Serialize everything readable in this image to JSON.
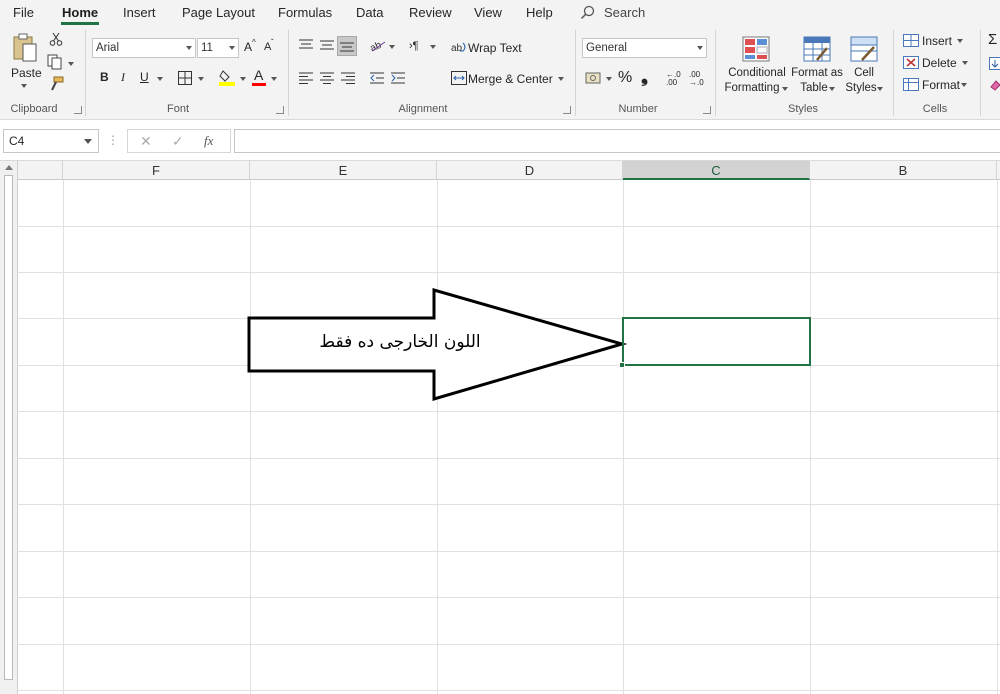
{
  "menu": {
    "tabs": [
      "File",
      "Home",
      "Insert",
      "Page Layout",
      "Formulas",
      "Data",
      "Review",
      "View",
      "Help"
    ],
    "active_tab": "Home",
    "search_label": "Search"
  },
  "ribbon": {
    "clipboard": {
      "paste": "Paste",
      "label": "Clipboard"
    },
    "font": {
      "name": "Arial",
      "size": "11",
      "label": "Font",
      "bold": "B",
      "italic": "I",
      "underline": "U",
      "grow": "A",
      "shrink": "A",
      "font_color": "A"
    },
    "alignment": {
      "wrap_text": "Wrap Text",
      "merge_center": "Merge & Center",
      "label": "Alignment"
    },
    "number": {
      "format": "General",
      "percent": "%",
      "comma": "❟",
      "label": "Number"
    },
    "styles": {
      "conditional_l1": "Conditional",
      "conditional_l2": "Formatting",
      "format_table_l1": "Format as",
      "format_table_l2": "Table",
      "cell_styles_l1": "Cell",
      "cell_styles_l2": "Styles",
      "label": "Styles"
    },
    "cells": {
      "insert": "Insert",
      "delete": "Delete",
      "format": "Format",
      "label": "Cells"
    },
    "colors": {
      "accent": "#217346",
      "highlight": "#ffff00",
      "font_red": "#ff0000"
    }
  },
  "formula_bar": {
    "name_box": "C4",
    "cancel": "✕",
    "enter": "✓",
    "fx": "fx",
    "value": ""
  },
  "sheet": {
    "columns": [
      "F",
      "E",
      "D",
      "C",
      "B"
    ],
    "selected_column": "C",
    "active_cell": "C4",
    "arrow_text": "اللون الخارجى ده فقط"
  }
}
